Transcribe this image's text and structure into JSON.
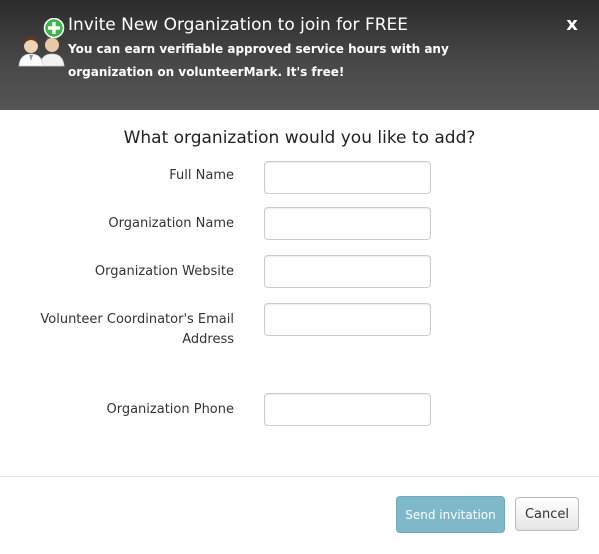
{
  "header": {
    "title": "Invite New Organization to join for FREE",
    "subtitle": "You can earn verifiable approved service hours with any organization on volunteerMark. It's free!",
    "close_label": "x",
    "icon": "add-users-icon"
  },
  "form": {
    "heading": "What organization would you like to add?",
    "fields": [
      {
        "label": "Full Name",
        "value": "",
        "placeholder": ""
      },
      {
        "label": "Organization Name",
        "value": "",
        "placeholder": ""
      },
      {
        "label": "Organization Website",
        "value": "",
        "placeholder": ""
      },
      {
        "label": "Volunteer Coordinator's Email Address",
        "value": "",
        "placeholder": ""
      },
      {
        "label": "Organization Phone",
        "value": "",
        "placeholder": ""
      }
    ]
  },
  "footer": {
    "send_label": "Send invitation",
    "cancel_label": "Cancel"
  },
  "colors": {
    "header_bg": "#3c3c3c",
    "send_button": "#7fb8c9",
    "plus_badge": "#3db54a"
  }
}
